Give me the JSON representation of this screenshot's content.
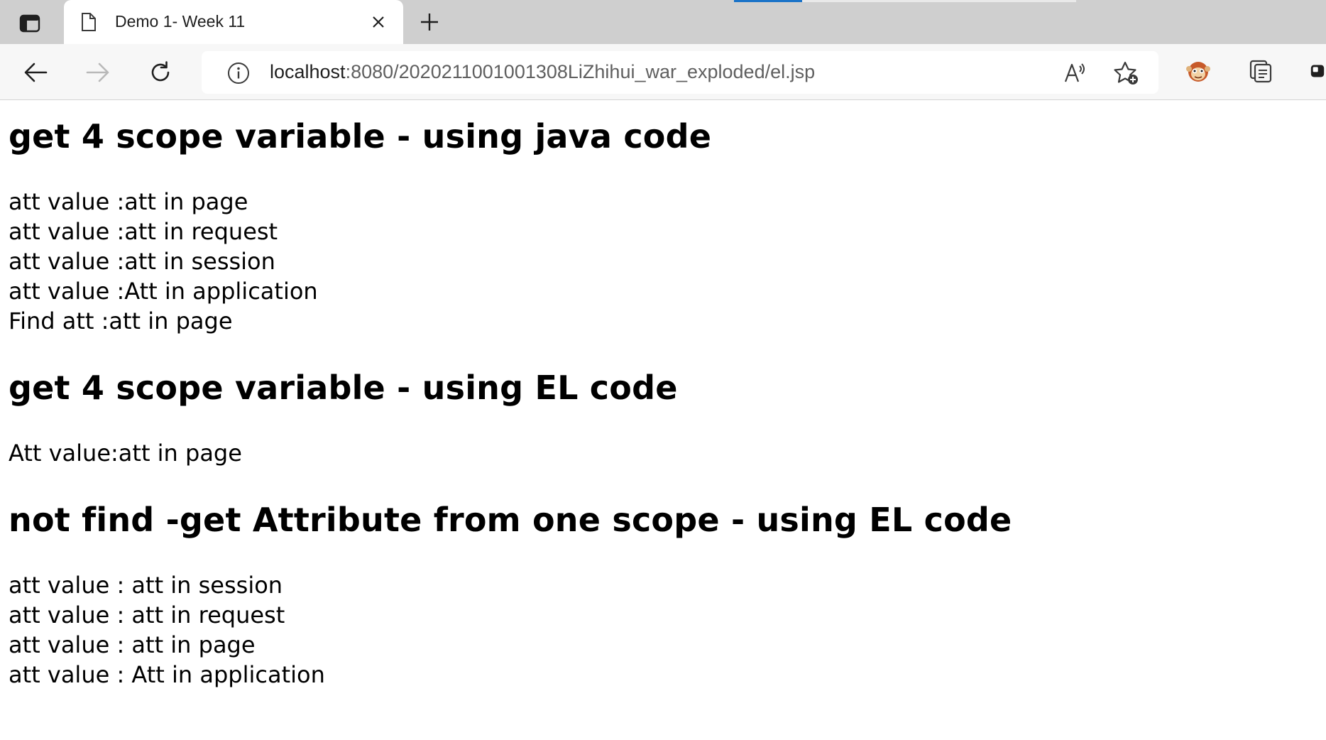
{
  "browser": {
    "tab": {
      "title": "Demo 1- Week 11",
      "favicon_icon": "document-icon",
      "close_icon": "close-icon"
    },
    "new_tab_icon": "plus-icon",
    "tab_actions_icon": "tab-actions-icon",
    "nav": {
      "back_icon": "arrow-left-icon",
      "forward_icon": "arrow-right-icon",
      "refresh_icon": "refresh-icon"
    },
    "address": {
      "info_icon": "info-icon",
      "url_host": "localhost",
      "url_path": ":8080/2020211001001308LiZhihui_war_exploded/el.jsp",
      "read_aloud_icon": "read-aloud-icon",
      "favorite_icon": "add-favorite-icon"
    },
    "extensions": {
      "extension_icon": "monkey-extension-icon",
      "collections_icon": "collections-icon",
      "profile_icon": "profile-icon"
    },
    "colors": {
      "loading_bar": "#1a73c8",
      "tab_strip": "#cfcfcf",
      "toolbar": "#f7f7f7"
    }
  },
  "page": {
    "section1": {
      "title": "get 4 scope variable - using java code",
      "lines": [
        "att value :att in page",
        "att value :att in request",
        "att value :att in session",
        "att value :Att in application",
        "Find att :att in page"
      ]
    },
    "section2": {
      "title": "get 4 scope variable - using EL code",
      "lines": [
        "Att value:att in page"
      ]
    },
    "section3": {
      "title": "not find -get Attribute from one scope - using EL code",
      "lines": [
        "att value : att in session",
        "att value : att in request",
        "att value : att in page",
        "att value : Att in application"
      ]
    }
  }
}
